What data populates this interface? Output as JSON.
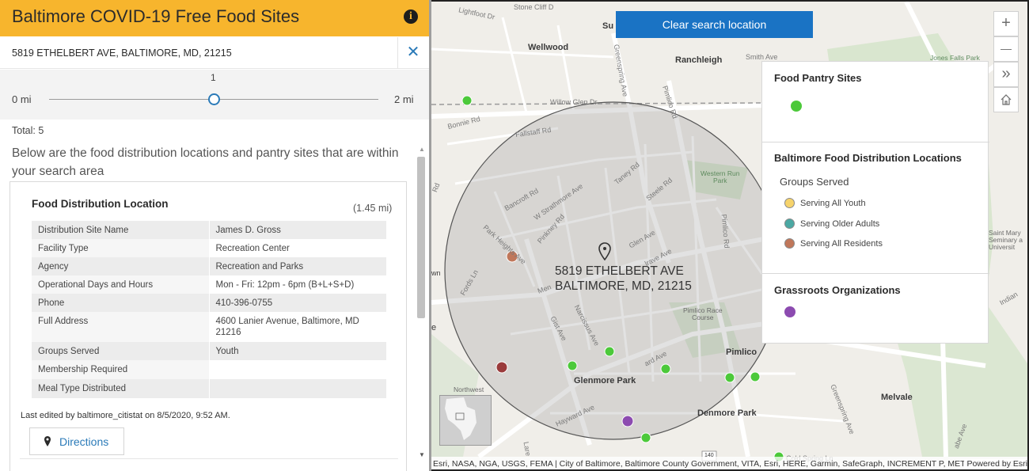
{
  "header": {
    "title": "Baltimore COVID-19 Free Food Sites",
    "info_icon": "info-icon"
  },
  "search": {
    "address": "5819 ETHELBERT AVE, BALTIMORE, MD, 21215",
    "clear_icon": "close-icon"
  },
  "slider": {
    "value": "1",
    "min_label": "0 mi",
    "max_label": "2 mi",
    "fraction": 0.5
  },
  "results": {
    "total": "Total: 5",
    "intro": "Below are the food distribution locations and pantry sites that are within your search area"
  },
  "card": {
    "title": "Food Distribution Location",
    "distance": "(1.45 mi)",
    "rows": [
      {
        "key": "Distribution Site Name",
        "value": "James D. Gross"
      },
      {
        "key": "Facility Type",
        "value": "Recreation Center"
      },
      {
        "key": "Agency",
        "value": "Recreation and Parks"
      },
      {
        "key": "Operational Days and Hours",
        "value": "Mon - Fri: 12pm - 6pm (B+L+S+D)"
      },
      {
        "key": "Phone",
        "value": "410-396-0755"
      },
      {
        "key": "Full Address",
        "value": "4600 Lanier Avenue, Baltimore, MD 21216"
      },
      {
        "key": "Groups Served",
        "value": "Youth"
      },
      {
        "key": "Membership Required",
        "value": ""
      },
      {
        "key": "Meal Type Distributed",
        "value": ""
      }
    ],
    "edited": "Last edited by baltimore_citistat on 8/5/2020, 9:52 AM.",
    "directions_label": "Directions"
  },
  "map": {
    "clear_search_label": "Clear search location",
    "zoom_in": "+",
    "zoom_out": "—",
    "expand": "»",
    "home_icon": "home-icon",
    "address_line1": "5819 ETHELBERT AVE",
    "address_line2": "BALTIMORE, MD, 21215",
    "attribution_left": "Esri, NASA, NGA, USGS, FEMA | City of Baltimore, Baltimore County Government, VITA, Esri, HERE, Garmin, SafeGraph, INCREMENT P, METI/NASA, USGS, EPA, NPS, USDA",
    "attribution_right": "Powered by Esri",
    "places": {
      "wellwood": "Wellwood",
      "ranchleigh": "Ranchleigh",
      "glenmore_park": "Glenmore Park",
      "denmore_park": "Denmore Park",
      "pimlico": "Pimlico",
      "melvale": "Melvale",
      "northwest": "Northwest",
      "jones_falls": "Jones Falls Park",
      "western_run": "Western Run\nPark",
      "pimlico_race": "Pimlico Race\nCourse",
      "saint_mary": "Saint Mary\nSeminary a\nUniversit",
      "sur": "Su",
      "wn": "wn",
      "e": "e",
      "highway": "140"
    },
    "roads": {
      "lightfoot": "Lightfoot Dr",
      "stone_cliff": "Stone Cliff D",
      "smith": "Smith Ave",
      "willow_glen": "Willow Glen Dr",
      "bonnie": "Bonnie Rd",
      "fallstaff": "Fallstaff Rd",
      "greenspring": "Greenspring Ave",
      "pimlico_rd": "Pimlico Rd",
      "pimlico_rd2": "Pimlico Rd",
      "taney": "Taney Rd",
      "steele": "Steele Rd",
      "bancroft": "Bancroft Rd",
      "strathmore": "W Strathmore Ave",
      "pinkney": "Pinkney Rd",
      "park_heights": "Park Heights Ave",
      "fords": "Fords Ln",
      "glen": "Glen Ave",
      "menlo": "Men",
      "narcissus": "Narcissus Ave",
      "gist": "Gist Ave",
      "hayward": "Hayward Ave",
      "hayward2": "Hayward Ave",
      "ard": "ard Ave",
      "greenspring2": "Greenspring Ave",
      "cold_spring": "Cold Spring Ln",
      "rd": "Rd",
      "indian": "Indian",
      "lare": "Lare",
      "rd_left": "Rd",
      "lrave": "lrave Ave",
      "jabe": "abe Ave"
    }
  },
  "legend": {
    "section1_title": "Food Pantry Sites",
    "section2_title": "Baltimore Food Distribution Locations",
    "groups_served": "Groups Served",
    "items": [
      {
        "label": "Serving All Youth",
        "color": "#f6d36b"
      },
      {
        "label": "Serving Older Adults",
        "color": "#4ba8a3"
      },
      {
        "label": "Serving All Residents",
        "color": "#c0775a"
      }
    ],
    "section3_title": "Grassroots Organizations",
    "pantry_color": "#4cc93a",
    "grassroots_color": "#8c4bb0"
  }
}
